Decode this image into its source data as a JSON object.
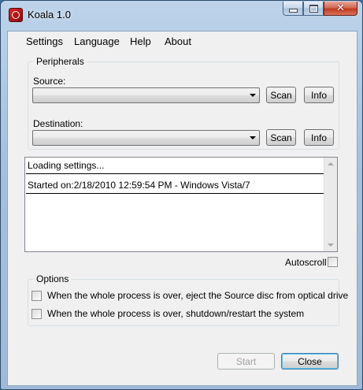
{
  "window": {
    "title": "Koala 1.0"
  },
  "menu": {
    "items": [
      "Settings",
      "Language",
      "Help",
      "About"
    ]
  },
  "peripherals": {
    "group_label": "Peripherals",
    "source_label": "Source:",
    "destination_label": "Destination:",
    "source_value": "",
    "destination_value": "",
    "scan_label": "Scan",
    "info_label": "Info"
  },
  "log": {
    "lines": [
      "Loading settings...",
      "Started on:2/18/2010 12:59:54 PM - Windows Vista/7"
    ]
  },
  "autoscroll": {
    "label": "Autoscroll",
    "checked": false
  },
  "options": {
    "group_label": "Options",
    "eject_label": "When the whole process is over, eject the Source disc from optical drive",
    "shutdown_label": "When the whole process is over, shutdown/restart the system",
    "eject_checked": false,
    "shutdown_checked": false
  },
  "buttons": {
    "start_label": "Start",
    "close_label": "Close"
  }
}
